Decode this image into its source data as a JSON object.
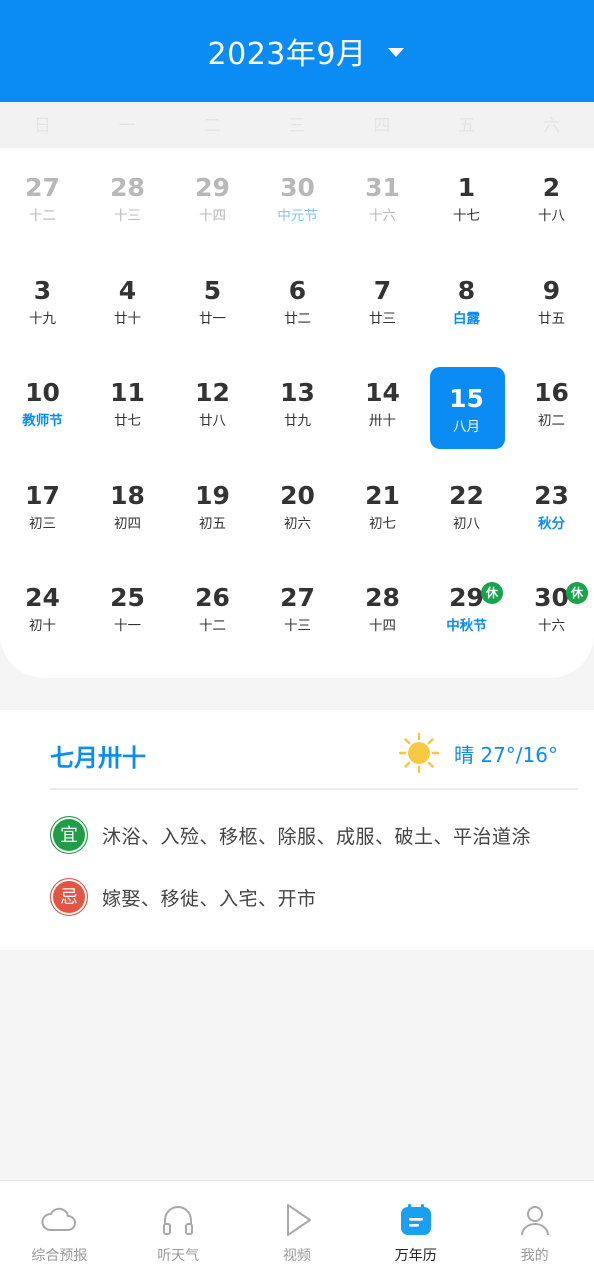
{
  "header": {
    "title": "2023年9月"
  },
  "weekdays": [
    "日",
    "一",
    "二",
    "三",
    "四",
    "五",
    "六"
  ],
  "calendar": {
    "rows": [
      [
        {
          "day": "27",
          "sub": "十二",
          "other": true
        },
        {
          "day": "28",
          "sub": "十三",
          "other": true
        },
        {
          "day": "29",
          "sub": "十四",
          "other": true
        },
        {
          "day": "30",
          "sub": "中元节",
          "other": true,
          "highlight": true
        },
        {
          "day": "31",
          "sub": "十六",
          "other": true
        },
        {
          "day": "1",
          "sub": "十七"
        },
        {
          "day": "2",
          "sub": "十八"
        }
      ],
      [
        {
          "day": "3",
          "sub": "十九"
        },
        {
          "day": "4",
          "sub": "廿十"
        },
        {
          "day": "5",
          "sub": "廿一"
        },
        {
          "day": "6",
          "sub": "廿二"
        },
        {
          "day": "7",
          "sub": "廿三"
        },
        {
          "day": "8",
          "sub": "白露",
          "highlight": true
        },
        {
          "day": "9",
          "sub": "廿五"
        }
      ],
      [
        {
          "day": "10",
          "sub": "教师节",
          "highlight": true
        },
        {
          "day": "11",
          "sub": "廿七"
        },
        {
          "day": "12",
          "sub": "廿八"
        },
        {
          "day": "13",
          "sub": "廿九"
        },
        {
          "day": "14",
          "sub": "卅十"
        },
        {
          "day": "15",
          "sub": "八月",
          "selected": true
        },
        {
          "day": "16",
          "sub": "初二"
        }
      ],
      [
        {
          "day": "17",
          "sub": "初三"
        },
        {
          "day": "18",
          "sub": "初四"
        },
        {
          "day": "19",
          "sub": "初五"
        },
        {
          "day": "20",
          "sub": "初六"
        },
        {
          "day": "21",
          "sub": "初七"
        },
        {
          "day": "22",
          "sub": "初八"
        },
        {
          "day": "23",
          "sub": "秋分",
          "highlight": true
        }
      ],
      [
        {
          "day": "24",
          "sub": "初十"
        },
        {
          "day": "25",
          "sub": "十一"
        },
        {
          "day": "26",
          "sub": "十二"
        },
        {
          "day": "27",
          "sub": "十三"
        },
        {
          "day": "28",
          "sub": "十四"
        },
        {
          "day": "29",
          "sub": "中秋节",
          "highlight": true,
          "badge": "休"
        },
        {
          "day": "30",
          "sub": "十六",
          "badge": "休"
        }
      ]
    ]
  },
  "info": {
    "lunar_date": "七月卅十",
    "weather": "晴 27°/16°",
    "weather_icon": "sun-icon",
    "yi_label": "宜",
    "yi_text": "沐浴、入殓、移柩、除服、成服、破土、平治道涂",
    "ji_label": "忌",
    "ji_text": "嫁娶、移徙、入宅、开市"
  },
  "colors": {
    "accent": "#0b8cf5",
    "yi": "#1f9e47",
    "ji": "#e35442",
    "rest_badge": "#19a34a"
  },
  "nav": [
    {
      "label": "综合预报",
      "icon": "cloud-icon"
    },
    {
      "label": "听天气",
      "icon": "headphones-icon"
    },
    {
      "label": "视频",
      "icon": "play-icon"
    },
    {
      "label": "万年历",
      "icon": "calendar-icon",
      "active": true
    },
    {
      "label": "我的",
      "icon": "user-icon"
    }
  ]
}
